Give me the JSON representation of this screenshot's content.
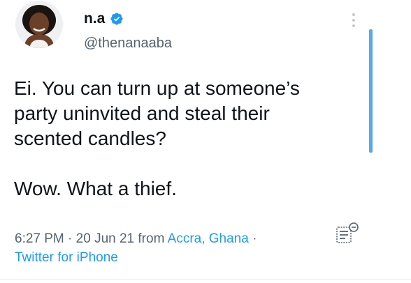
{
  "author": {
    "display_name": "n.a",
    "handle": "@thenanaaba",
    "verified_icon": "verified-badge-icon",
    "avatar_icon": "profile-photo"
  },
  "tweet": {
    "lines": [
      "Ei. You can turn up at someone’s",
      "party uninvited and steal their",
      "scented candles?"
    ],
    "closing": "Wow. What a thief."
  },
  "meta": {
    "time": "6:27 PM",
    "sep1": " · ",
    "date": "20 Jun 21",
    "from": " from ",
    "location": "Accra, Ghana",
    "sep2": " ·",
    "source": "Twitter for iPhone"
  },
  "colors": {
    "text": "#0f1419",
    "secondary": "#536471",
    "link": "#1d9bf0",
    "verified": "#1d9bf0",
    "scrollbar": "#5aa9e6"
  }
}
